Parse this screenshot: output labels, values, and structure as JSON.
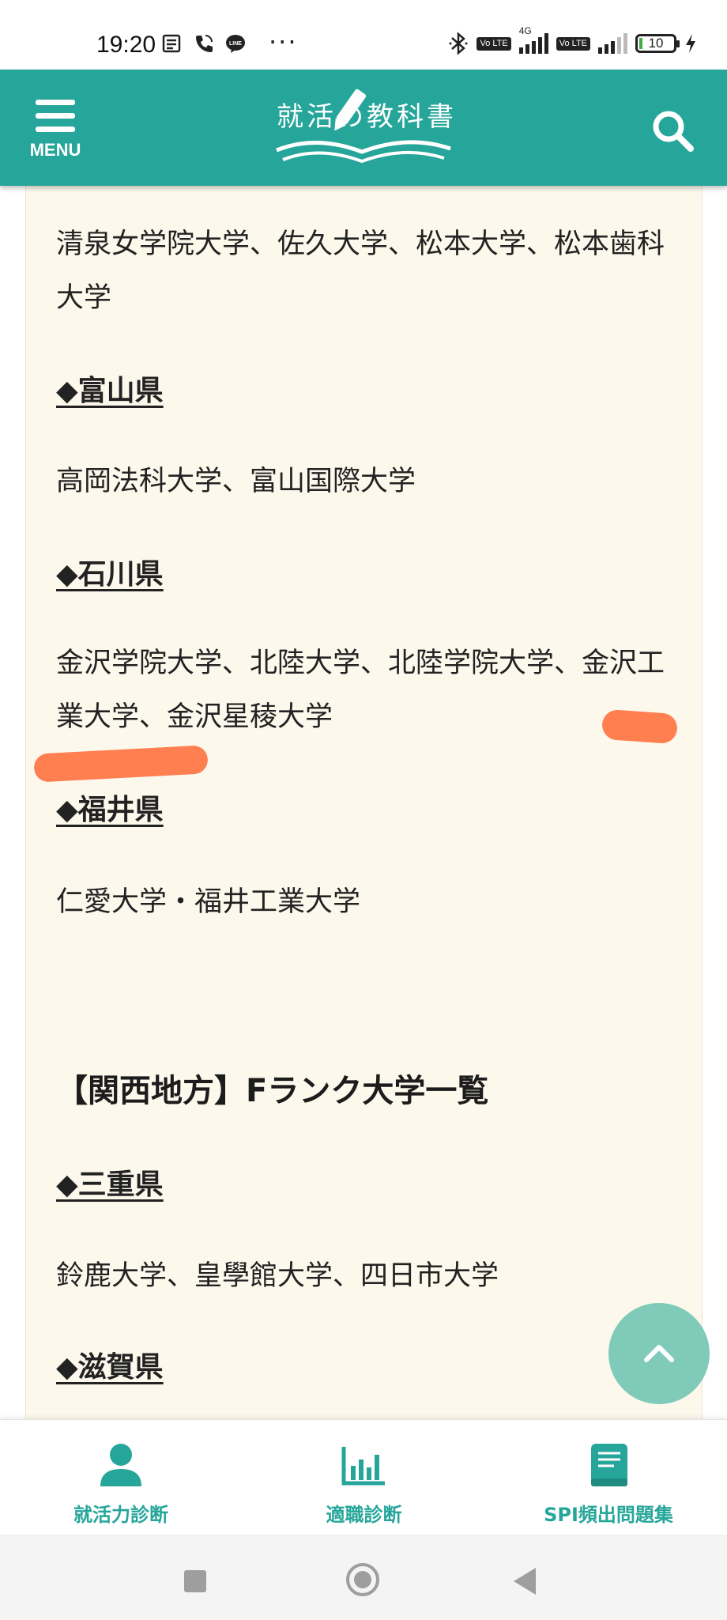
{
  "status_bar": {
    "time": "19:20",
    "left_icons": [
      "news-icon",
      "phone-call-icon",
      "line-app-icon"
    ],
    "overflow": "···",
    "right_icons": [
      "bluetooth-icon",
      "volte-icon",
      "4g-signal-icon",
      "volte-icon",
      "signal-icon",
      "battery-icon",
      "charging-icon"
    ],
    "volte_label": "Vo LTE",
    "network_label": "4G",
    "battery_level": "10",
    "battery_fraction": 0.1
  },
  "header": {
    "menu_label": "MENU",
    "logo_text": "就活の教科書",
    "bg_color": "#26a69a"
  },
  "content": {
    "para_nagano_cont": "清泉女学院大学、佐久大学、松本大学、松本歯科大学",
    "pref_toyama": "◆富山県",
    "para_toyama": "高岡法科大学、富山国際大学",
    "pref_ishikawa": "◆石川県",
    "para_ishikawa": "金沢学院大学、北陸大学、北陸学院大学、金沢工業大学、金沢星稜大学",
    "pref_fukui": "◆福井県",
    "para_fukui": "仁愛大学・福井工業大学",
    "section_kansai": "【関西地方】Fランク大学一覧",
    "pref_mie": "◆三重県",
    "para_mie": "鈴鹿大学、皇學館大学、四日市大学",
    "pref_shiga": "◆滋賀県"
  },
  "bottom_nav": {
    "items": [
      {
        "label": "就活力診断",
        "icon": "person-icon"
      },
      {
        "label": "適職診断",
        "icon": "bar-chart-icon"
      },
      {
        "label": "SPI頻出問題集",
        "icon": "book-icon"
      }
    ]
  },
  "colors": {
    "accent": "#26a69a",
    "card_bg": "#fcf8ec",
    "scribble": "#ff7f50",
    "scroll_top": "#7fcab9"
  }
}
